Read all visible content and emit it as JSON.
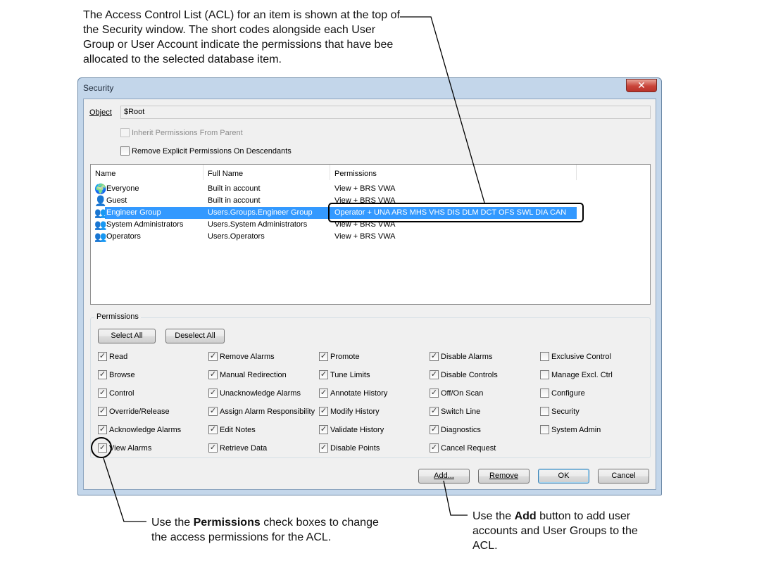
{
  "callouts": {
    "top": "The Access Control List (ACL) for an item is shown at the top of the Security window. The short codes alongside each User Group or User Account indicate the permissions that have bee allocated to the selected database item.",
    "perm_pre": "Use the ",
    "perm_bold": "Permissions",
    "perm_post": " check boxes to change the access permissions for the ACL.",
    "add_pre": "Use the ",
    "add_bold": "Add",
    "add_post": " button to add user accounts and User Groups to the ACL."
  },
  "window": {
    "title": "Security",
    "close_glyph": "✕"
  },
  "object": {
    "label": "Object",
    "value": "$Root"
  },
  "options": {
    "inherit": "Inherit Permissions From Parent",
    "remove_explicit": "Remove Explicit Permissions On Descendants"
  },
  "acl": {
    "columns": [
      "Name",
      "Full Name",
      "Permissions"
    ],
    "rows": [
      {
        "name": "Everyone",
        "full_name": "Built in account",
        "permissions": "View + BRS VWA",
        "icon": "globe-user"
      },
      {
        "name": "Guest",
        "full_name": "Built in account",
        "permissions": "View + BRS VWA",
        "icon": "guest-user"
      },
      {
        "name": "Engineer Group",
        "full_name": "Users.Groups.Engineer Group",
        "permissions": "Operator + UNA ARS MHS VHS DIS DLM DCT OFS SWL DIA CAN",
        "icon": "group"
      },
      {
        "name": "System Administrators",
        "full_name": "Users.System Administrators",
        "permissions": "View + BRS VWA",
        "icon": "group"
      },
      {
        "name": "Operators",
        "full_name": "Users.Operators",
        "permissions": "View + BRS VWA",
        "icon": "group"
      }
    ],
    "selected_index": 2
  },
  "permissions": {
    "legend": "Permissions",
    "select_all": "Select All",
    "deselect_all": "Deselect All",
    "columns": [
      [
        {
          "label": "Read",
          "checked": true
        },
        {
          "label": "Browse",
          "checked": true
        },
        {
          "label": "Control",
          "checked": true
        },
        {
          "label": "Override/Release",
          "checked": true
        },
        {
          "label": "Acknowledge Alarms",
          "checked": true
        },
        {
          "label": "View Alarms",
          "checked": true
        }
      ],
      [
        {
          "label": "Remove Alarms",
          "checked": true
        },
        {
          "label": "Manual Redirection",
          "checked": true
        },
        {
          "label": "Unacknowledge Alarms",
          "checked": true
        },
        {
          "label": "Assign Alarm Responsibility",
          "checked": true
        },
        {
          "label": "Edit Notes",
          "checked": true
        },
        {
          "label": "Retrieve Data",
          "checked": true
        }
      ],
      [
        {
          "label": "Promote",
          "checked": true
        },
        {
          "label": "Tune Limits",
          "checked": true
        },
        {
          "label": "Annotate History",
          "checked": true
        },
        {
          "label": "Modify History",
          "checked": true
        },
        {
          "label": "Validate History",
          "checked": true
        },
        {
          "label": "Disable Points",
          "checked": true
        }
      ],
      [
        {
          "label": "Disable Alarms",
          "checked": true
        },
        {
          "label": "Disable Controls",
          "checked": true
        },
        {
          "label": "Off/On Scan",
          "checked": true
        },
        {
          "label": "Switch Line",
          "checked": true
        },
        {
          "label": "Diagnostics",
          "checked": true
        },
        {
          "label": "Cancel Request",
          "checked": true
        }
      ],
      [
        {
          "label": "Exclusive Control",
          "checked": false
        },
        {
          "label": "Manage Excl. Ctrl",
          "checked": false
        },
        {
          "label": "Configure",
          "checked": false
        },
        {
          "label": "Security",
          "checked": false
        },
        {
          "label": "System Admin",
          "checked": false
        }
      ]
    ]
  },
  "buttons": {
    "add": "Add...",
    "remove": "Remove",
    "ok": "OK",
    "cancel": "Cancel"
  }
}
